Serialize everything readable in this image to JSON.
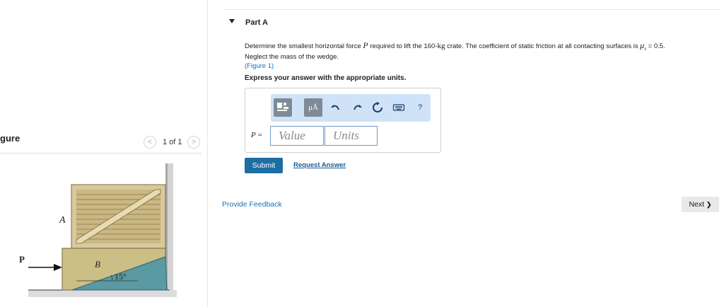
{
  "figure_pane": {
    "title": "gure",
    "prev_icon": "chevron-left-icon",
    "next_icon": "chevron-right-icon",
    "prev_glyph": "<",
    "next_glyph": ">",
    "counter": "1 of 1",
    "labels": {
      "A": "A",
      "B": "B",
      "P": "P",
      "angle": "15°"
    },
    "colors": {
      "crate": "#d7c89a",
      "wedge_upper": "#cbc084",
      "wedge_lower": "#5b9aa3",
      "wall": "#d2d2d2"
    }
  },
  "part": {
    "caret_icon": "triangle-down-icon",
    "title": "Part A",
    "problem_before_mass": "Determine the smallest horizontal force",
    "force_symbol": "P",
    "problem_mid": "required to lift the 160-",
    "mass_unit": "kg",
    "problem_after_mass": "crate. The coefficient of static friction at all contacting surfaces is",
    "mu_symbol": "μ",
    "mu_subscript": "s",
    "mu_value": "= 0.5.",
    "problem_line2": "Neglect the mass of the wedge.",
    "figure_link": "(Figure 1)",
    "instruction": "Express your answer with the appropriate units."
  },
  "toolbar": {
    "templates_icon": "template-icon",
    "units_label": "μÅ",
    "undo_icon": "undo-icon",
    "redo_icon": "redo-icon",
    "reset_icon": "reset-icon",
    "keyboard_icon": "keyboard-icon",
    "help_label": "?",
    "accent": "#cfe2f7"
  },
  "answer": {
    "variable": "P",
    "equals": "=",
    "value_placeholder": "Value",
    "units_placeholder": "Units"
  },
  "actions": {
    "submit": "Submit",
    "request_answer": "Request Answer",
    "provide_feedback": "Provide Feedback",
    "next": "Next",
    "next_glyph": "❯"
  }
}
